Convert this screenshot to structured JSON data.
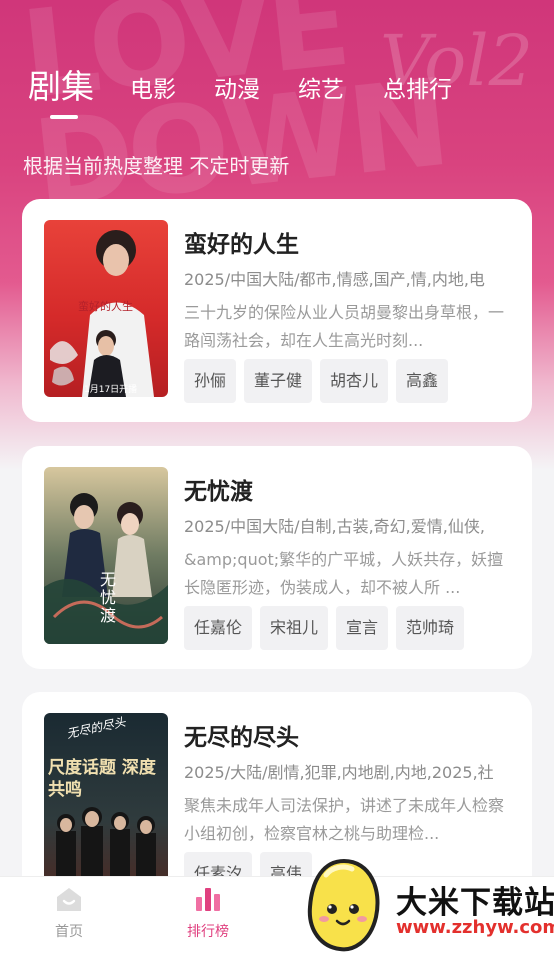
{
  "tabs": [
    {
      "label": "剧集",
      "active": true
    },
    {
      "label": "电影",
      "active": false
    },
    {
      "label": "动漫",
      "active": false
    },
    {
      "label": "综艺",
      "active": false
    },
    {
      "label": "总排行",
      "active": false
    }
  ],
  "subtitle": "根据当前热度整理 不定时更新",
  "shows": [
    {
      "title": "蛮好的人生",
      "meta": "2025/中国大陆/都市,情感,国产,情,内地,电",
      "desc": "三十九岁的保险从业人员胡曼黎出身草根，一路闯荡社会，却在人生高光时刻...",
      "tags": [
        "孙俪",
        "董子健",
        "胡杏儿",
        "高鑫"
      ],
      "poster_text": "蛮好的人生",
      "poster_caption": "1月17日开播"
    },
    {
      "title": "无忧渡",
      "meta": "2025/中国大陆/自制,古装,奇幻,爱情,仙侠,",
      "desc": "&amp;quot;繁华的广平城，人妖共存，妖擅长隐匿形迹，伪装成人，却不被人所 ...",
      "tags": [
        "任嘉伦",
        "宋祖儿",
        "宣言",
        "范帅琦"
      ],
      "poster_text": "无忧渡"
    },
    {
      "title": "无尽的尽头",
      "meta": "2025/大陆/剧情,犯罪,内地剧,内地,2025,社",
      "desc": "聚焦未成年人司法保护，讲述了未成年人检察小组初创，检察官林之桃与助理检...",
      "tags": [
        "任素汐",
        "高伟",
        "",
        ""
      ],
      "poster_text": "尺度话题 深度共鸣",
      "poster_top": "无尽的尽头"
    }
  ],
  "bottom_nav": [
    {
      "label": "首页",
      "icon": "home-icon",
      "active": false
    },
    {
      "label": "排行榜",
      "icon": "ranking-icon",
      "active": true
    }
  ],
  "watermark": {
    "title": "大米下载站",
    "url": "www.zzhyw.com"
  },
  "colors": {
    "accent": "#e0407f",
    "hero": "#d0367a"
  }
}
